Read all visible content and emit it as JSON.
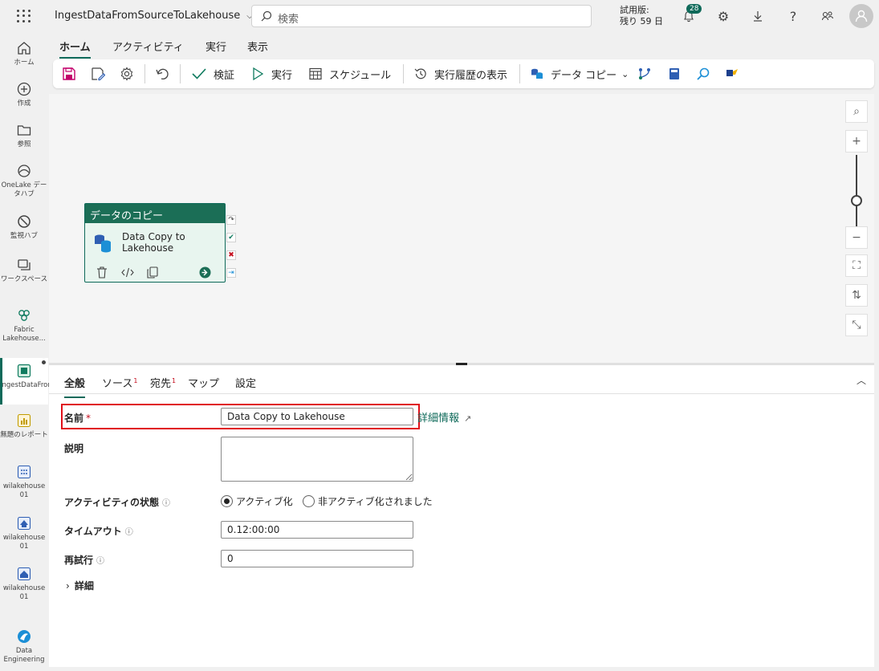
{
  "header": {
    "app_title": "IngestDataFromSourceToLakehouse",
    "search_placeholder": "検索",
    "trial_line1": "試用版:",
    "trial_line2": "残り 59 日",
    "notification_count": "28"
  },
  "rail": {
    "items": [
      {
        "label": "ホーム",
        "icon": "home-icon"
      },
      {
        "label": "作成",
        "icon": "create-icon"
      },
      {
        "label": "参照",
        "icon": "folder-icon"
      },
      {
        "label": "OneLake データハブ",
        "icon": "onelake-icon"
      },
      {
        "label": "監視ハブ",
        "icon": "monitor-icon"
      },
      {
        "label": "ワークスペース",
        "icon": "workspaces-icon"
      },
      {
        "label": "Fabric Lakehouse...",
        "icon": "fabric-icon"
      },
      {
        "label": "IngestDataFromSourc...",
        "icon": "pipeline-icon"
      },
      {
        "label": "無題のレポート",
        "icon": "report-icon"
      },
      {
        "label": "wilakehouse 01",
        "icon": "lakehouse-icon"
      },
      {
        "label": "wilakehouse 01",
        "icon": "sql-endpoint-icon"
      },
      {
        "label": "wilakehouse 01",
        "icon": "semantic-model-icon"
      },
      {
        "label": "Data Engineering",
        "icon": "data-engineering-icon"
      }
    ]
  },
  "menu": {
    "tabs": [
      "ホーム",
      "アクティビティ",
      "実行",
      "表示"
    ]
  },
  "toolbar": {
    "validate": "検証",
    "run": "実行",
    "schedule": "スケジュール",
    "view_history": "実行履歴の表示",
    "copy_data": "データ コピー"
  },
  "canvas": {
    "activity_type": "データのコピー",
    "activity_name_line1": "Data Copy to",
    "activity_name_line2": "Lakehouse"
  },
  "properties": {
    "tabs": [
      {
        "label": "全般",
        "badge": ""
      },
      {
        "label": "ソース",
        "badge": "1"
      },
      {
        "label": "宛先",
        "badge": "1"
      },
      {
        "label": "マップ",
        "badge": ""
      },
      {
        "label": "設定",
        "badge": ""
      }
    ],
    "name_label": "名前",
    "name_value": "Data Copy to Lakehouse",
    "detail_link": "詳細情報",
    "description_label": "説明",
    "state_label": "アクティビティの状態",
    "state_active": "アクティブ化",
    "state_inactive": "非アクティブ化されました",
    "timeout_label": "タイムアウト",
    "timeout_value": "0.12:00:00",
    "retry_label": "再試行",
    "retry_value": "0",
    "advanced_label": "詳細"
  },
  "colors": {
    "accent": "#0f6a5a",
    "highlight_box": "#e0101a"
  }
}
